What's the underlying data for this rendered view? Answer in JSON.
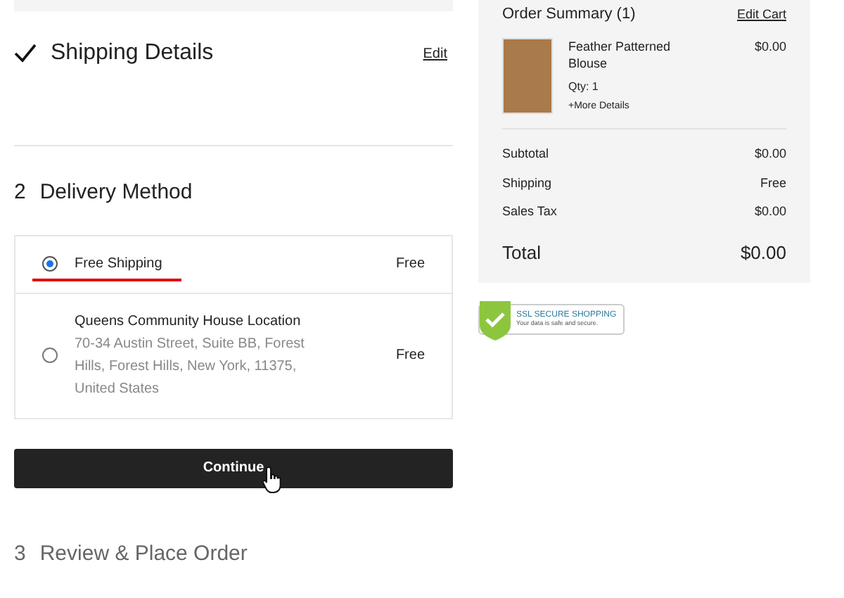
{
  "shipping_details": {
    "title": "Shipping Details",
    "completed": true,
    "edit_link": "Edit"
  },
  "delivery_method": {
    "step": "2",
    "title": "Delivery Method",
    "options": [
      {
        "name": "Free Shipping",
        "price": "Free",
        "selected": true
      },
      {
        "name": "Queens Community House Location",
        "address": "70-34 Austin Street, Suite BB, Forest Hills, Forest Hills, New York, 11375, United States",
        "price": "Free",
        "selected": false
      }
    ],
    "button": "Continue"
  },
  "review": {
    "step": "3",
    "title": "Review & Place Order"
  },
  "order_summary": {
    "title": "Order Summary (1)",
    "edit_link": "Edit Cart",
    "items": [
      {
        "name": "Feather Patterned Blouse",
        "qty": "Qty: 1",
        "more": "+More Details",
        "price": "$0.00"
      }
    ],
    "lines": [
      {
        "label": "Subtotal",
        "value": "$0.00"
      },
      {
        "label": "Shipping",
        "value": "Free"
      },
      {
        "label": "Sales Tax",
        "value": "$0.00"
      }
    ],
    "total": {
      "label": "Total",
      "value": "$0.00"
    }
  },
  "badge": {
    "title": "SSL SECURE SHOPPING",
    "subtitle": "Your data is safe and secure."
  }
}
